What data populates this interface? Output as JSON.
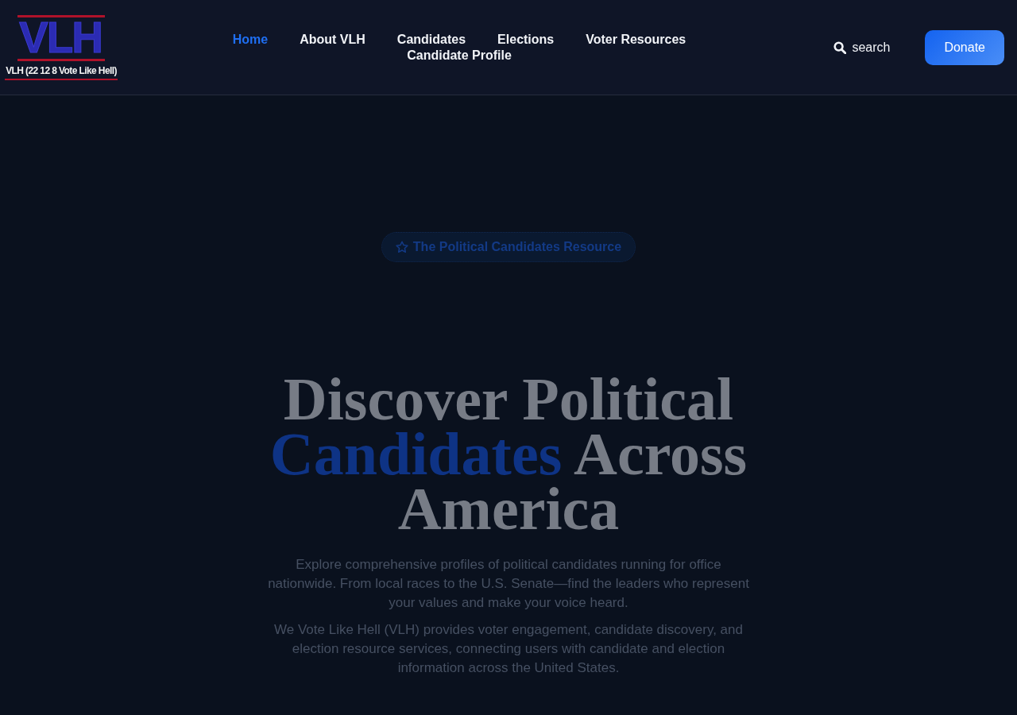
{
  "header": {
    "logo": {
      "mark": "VLH",
      "caption": "VLH (22 12 8 Vote Like Hell)"
    },
    "nav": [
      {
        "label": "Home",
        "selected": true
      },
      {
        "label": "About VLH",
        "selected": false
      },
      {
        "label": "Candidates",
        "selected": false
      },
      {
        "label": "Elections",
        "selected": false
      },
      {
        "label": "Voter Resources",
        "selected": false
      },
      {
        "label": "Candidate Profile",
        "selected": false
      }
    ],
    "search": {
      "label": "search"
    },
    "donate": {
      "label": "Donate"
    }
  },
  "hero": {
    "badge": {
      "label": "The Political Candidates Resource"
    },
    "heading": [
      {
        "text": "Discover Political ",
        "highlight": false
      },
      {
        "text": "Candidates",
        "highlight": true
      },
      {
        "text": " Across America",
        "highlight": false
      }
    ],
    "paragraphs": [
      "Explore comprehensive profiles of political candidates running for office nationwide. From local races to the U.S. Senate—find the leaders who represent your values and make your voice heard.",
      "We Vote Like Hell (VLH) provides voter engagement, candidate discovery, and election resource services, connecting users with candidate and election information across the United States."
    ]
  }
}
